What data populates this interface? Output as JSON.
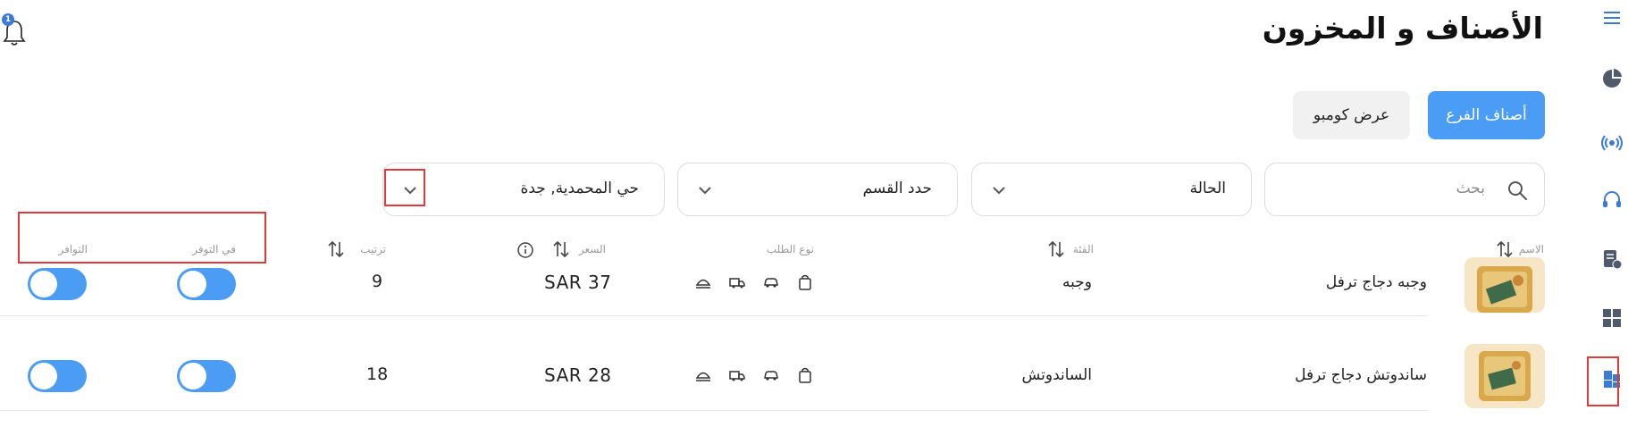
{
  "header": {
    "title": "الأصناف و المخزون",
    "notification_count": "1"
  },
  "tabs": [
    {
      "label": "أصناف الفرع",
      "active": true
    },
    {
      "label": "عرض كومبو",
      "active": false
    }
  ],
  "filters": {
    "search_placeholder": "بحث",
    "status_label": "الحالة",
    "section_label": "حدد القسم",
    "branch_label": "حي المحمدية, جدة"
  },
  "table": {
    "columns": {
      "name": "الاسم",
      "category": "الفئة",
      "order_type": "نوع الطلب",
      "price": "السعر",
      "order": "ترتيب",
      "in_availability": "في التوفر",
      "availability": "التوافر"
    },
    "rows": [
      {
        "name": "وجبه دجاج ترفل",
        "category": "وجبه",
        "price": "SAR 37",
        "order": "9",
        "in_availability": true,
        "availability": true
      },
      {
        "name": "ساندوتش دجاج ترفل",
        "category": "الساندوتش",
        "price": "SAR 28",
        "order": "18",
        "in_availability": true,
        "availability": true
      }
    ]
  },
  "sidebar": {
    "items": [
      {
        "icon": "menu-icon"
      },
      {
        "icon": "pie-chart-icon"
      },
      {
        "icon": "broadcast-icon"
      },
      {
        "icon": "headset-icon"
      },
      {
        "icon": "report-clock-icon"
      },
      {
        "icon": "grid-icon"
      },
      {
        "icon": "inventory-icon",
        "active": true
      }
    ]
  },
  "colors": {
    "accent": "#4a9cf5",
    "highlight": "#e03b3b",
    "rail_icon": "#3a7bd5"
  }
}
